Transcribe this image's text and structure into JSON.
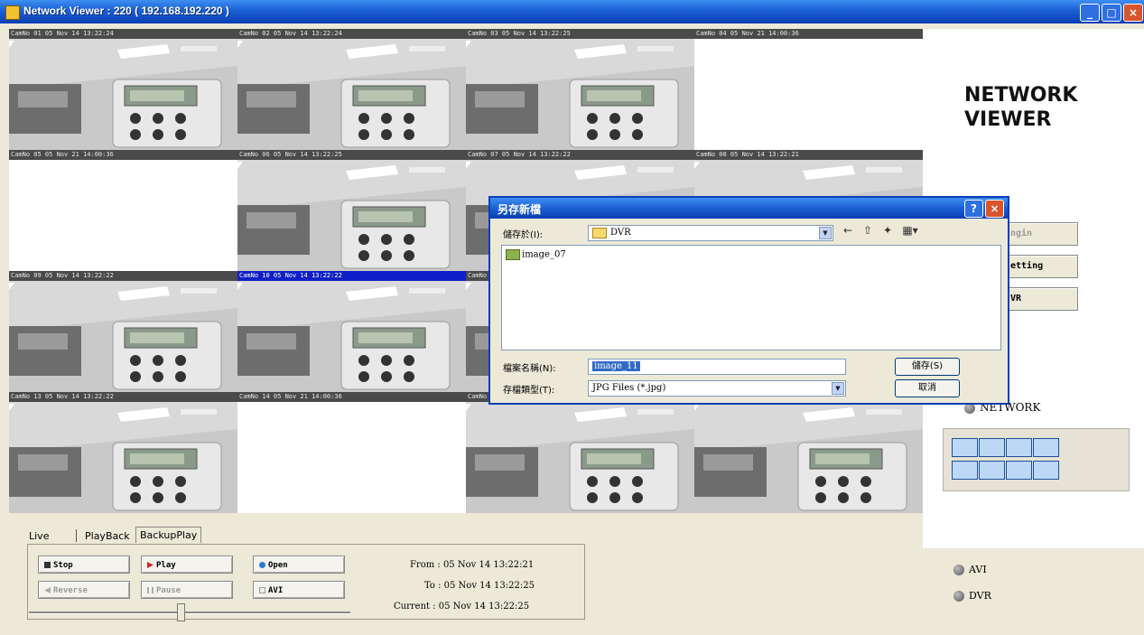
{
  "window": {
    "title": "Network Viewer : 220 ( 192.168.192.220 )"
  },
  "cameras": [
    {
      "label": "CamNo 01 05 Nov 14 13:22:24",
      "live": true
    },
    {
      "label": "CamNo 02 05 Nov 14 13:22:24",
      "live": true
    },
    {
      "label": "CamNo 03 05 Nov 14 13:22:25",
      "live": true
    },
    {
      "label": "CamNo 04 05 Nov 21 14:00:36",
      "live": false
    },
    {
      "label": "CamNo 05 05 Nov 21 14:00:36",
      "live": false
    },
    {
      "label": "CamNo 06 05 Nov 14 13:22:25",
      "live": true
    },
    {
      "label": "CamNo 07 05 Nov 14 13:22:22",
      "live": true
    },
    {
      "label": "CamNo 08 05 Nov 14 13:22:21",
      "live": true
    },
    {
      "label": "CamNo 09 05 Nov 14 13:22:22",
      "live": true
    },
    {
      "label": "CamNo 10 05 Nov 14 13:22:22",
      "live": true,
      "selected": true
    },
    {
      "label": "CamNo 11",
      "live": true
    },
    {
      "label": "",
      "live": true
    },
    {
      "label": "CamNo 13 05 Nov 14 13:22:22",
      "live": true
    },
    {
      "label": "CamNo 14 05 Nov 21 14:00:36",
      "live": false
    },
    {
      "label": "CamNo 15",
      "live": true
    },
    {
      "label": "",
      "live": true
    }
  ],
  "right_panel": {
    "logo_line1": "NETWORK",
    "logo_line2": "VIEWER",
    "btn_partial_1": "ngin",
    "btn_setting": "etting",
    "btn_dvr": "VR",
    "network_label": "NETWORK",
    "avi_label": "AVI",
    "dvr_label": "DVR"
  },
  "tabs": {
    "live": "Live",
    "playback": "PlayBack",
    "backup_play": "BackupPlay"
  },
  "controls": {
    "stop": "Stop",
    "play": "Play",
    "open": "Open",
    "reverse": "Reverse",
    "pause": "Pause",
    "avi": "AVI",
    "slider_position": 0.47
  },
  "info": {
    "from": "From : 05 Nov 14 13:22:21",
    "to": "To : 05 Nov 14 13:22:25",
    "current": "Current : 05 Nov 14 13:22:25"
  },
  "dialog": {
    "title": "另存新檔",
    "save_in_label": "儲存於(I):",
    "save_in_value": "DVR",
    "file_item": "image_07",
    "filename_label": "檔案名稱(N):",
    "filename_value": "image_11",
    "filetype_label": "存檔類型(T):",
    "filetype_value": "JPG Files (*.jpg)",
    "save_button": "儲存(S)",
    "cancel_button": "取消",
    "help_glyph": "?",
    "close_glyph": "×"
  },
  "colors": {
    "xp_blue": "#0a3fb3",
    "selected_outline": "#0016c8",
    "window_bg": "#ece9d8"
  }
}
